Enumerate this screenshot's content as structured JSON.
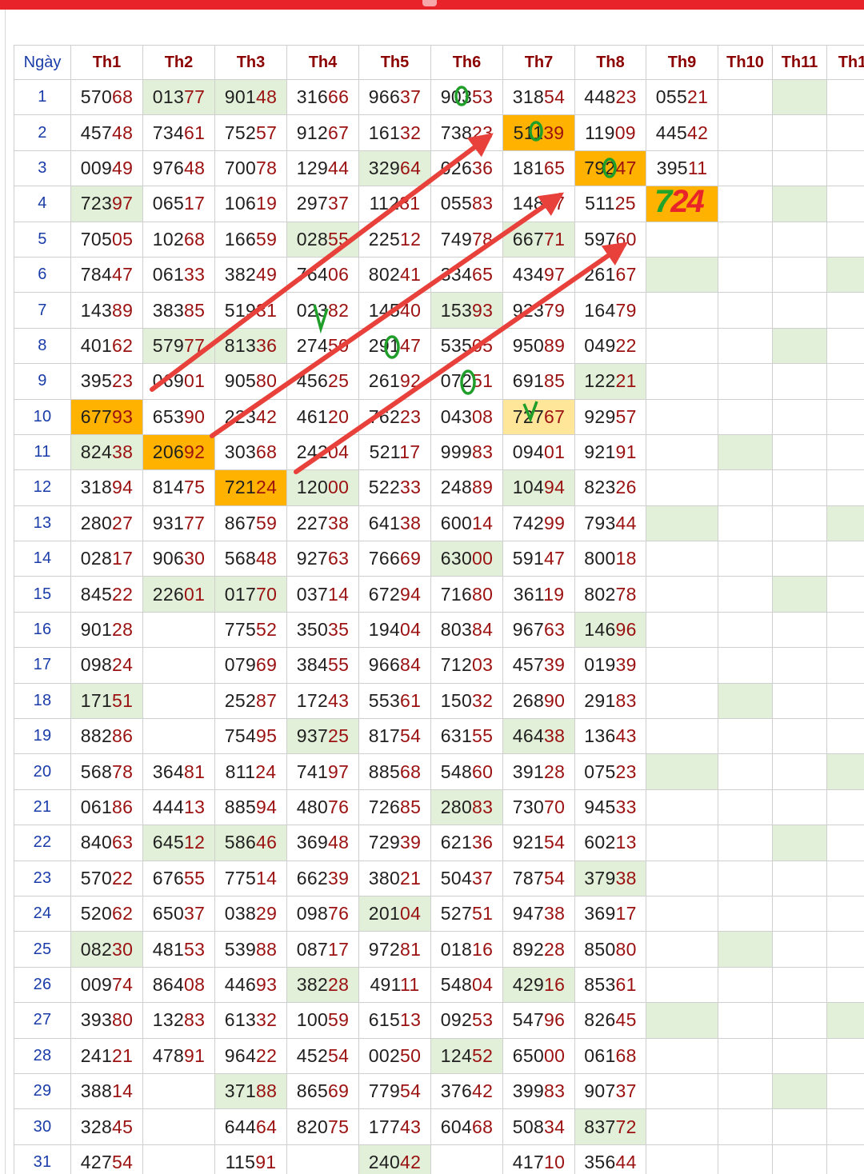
{
  "header": {
    "day_label": "Ngày",
    "months": [
      "Th1",
      "Th2",
      "Th3",
      "Th4",
      "Th5",
      "Th6",
      "Th7",
      "Th8",
      "Th9",
      "Th10",
      "Th11",
      "Th1"
    ]
  },
  "rows": [
    {
      "day": "1",
      "cells": [
        "57068",
        "01377",
        "90148",
        "31666",
        "96637",
        "90353",
        "31854",
        "44823",
        "05521",
        "",
        "",
        ""
      ]
    },
    {
      "day": "2",
      "cells": [
        "45748",
        "73461",
        "75257",
        "91267",
        "16132",
        "73823",
        "51139",
        "11909",
        "44542",
        "",
        "",
        ""
      ]
    },
    {
      "day": "3",
      "cells": [
        "00949",
        "97648",
        "70078",
        "12944",
        "32964",
        "02636",
        "18165",
        "79247",
        "39511",
        "",
        "",
        ""
      ]
    },
    {
      "day": "4",
      "cells": [
        "72397",
        "06517",
        "10619",
        "29737",
        "11281",
        "05583",
        "14887",
        "51125",
        "",
        "",
        "",
        ""
      ]
    },
    {
      "day": "5",
      "cells": [
        "70505",
        "10268",
        "16659",
        "02855",
        "22512",
        "74978",
        "66771",
        "59760",
        "",
        "",
        "",
        ""
      ]
    },
    {
      "day": "6",
      "cells": [
        "78447",
        "06133",
        "38249",
        "76406",
        "80241",
        "33465",
        "43497",
        "26167",
        "",
        "",
        "",
        ""
      ]
    },
    {
      "day": "7",
      "cells": [
        "14389",
        "38385",
        "51931",
        "02382",
        "14540",
        "15393",
        "92379",
        "16479",
        "",
        "",
        "",
        ""
      ]
    },
    {
      "day": "8",
      "cells": [
        "40162",
        "57977",
        "81336",
        "27450",
        "29147",
        "53505",
        "95089",
        "04922",
        "",
        "",
        "",
        ""
      ]
    },
    {
      "day": "9",
      "cells": [
        "39523",
        "06901",
        "90580",
        "45625",
        "26192",
        "07251",
        "69185",
        "12221",
        "",
        "",
        "",
        ""
      ]
    },
    {
      "day": "10",
      "cells": [
        "67793",
        "65390",
        "22342",
        "46120",
        "76223",
        "04308",
        "72767",
        "92957",
        "",
        "",
        "",
        ""
      ]
    },
    {
      "day": "11",
      "cells": [
        "82438",
        "20692",
        "30368",
        "24204",
        "52117",
        "99983",
        "09401",
        "92191",
        "",
        "",
        "",
        ""
      ]
    },
    {
      "day": "12",
      "cells": [
        "31894",
        "81475",
        "72124",
        "12000",
        "52233",
        "24889",
        "10494",
        "82326",
        "",
        "",
        "",
        ""
      ]
    },
    {
      "day": "13",
      "cells": [
        "28027",
        "93177",
        "86759",
        "22738",
        "64138",
        "60014",
        "74299",
        "79344",
        "",
        "",
        "",
        ""
      ]
    },
    {
      "day": "14",
      "cells": [
        "02817",
        "90630",
        "56848",
        "92763",
        "76669",
        "63000",
        "59147",
        "80018",
        "",
        "",
        "",
        ""
      ]
    },
    {
      "day": "15",
      "cells": [
        "84522",
        "22601",
        "01770",
        "03714",
        "67294",
        "71680",
        "36119",
        "80278",
        "",
        "",
        "",
        ""
      ]
    },
    {
      "day": "16",
      "cells": [
        "90128",
        "",
        "77552",
        "35035",
        "19404",
        "80384",
        "96763",
        "14696",
        "",
        "",
        "",
        ""
      ]
    },
    {
      "day": "17",
      "cells": [
        "09824",
        "",
        "07969",
        "38455",
        "96684",
        "71203",
        "45739",
        "01939",
        "",
        "",
        "",
        ""
      ]
    },
    {
      "day": "18",
      "cells": [
        "17151",
        "",
        "25287",
        "17243",
        "55361",
        "15032",
        "26890",
        "29183",
        "",
        "",
        "",
        ""
      ]
    },
    {
      "day": "19",
      "cells": [
        "88286",
        "",
        "75495",
        "93725",
        "81754",
        "63155",
        "46438",
        "13643",
        "",
        "",
        "",
        ""
      ]
    },
    {
      "day": "20",
      "cells": [
        "56878",
        "36481",
        "81124",
        "74197",
        "88568",
        "54860",
        "39128",
        "07523",
        "",
        "",
        "",
        ""
      ]
    },
    {
      "day": "21",
      "cells": [
        "06186",
        "44413",
        "88594",
        "48076",
        "72685",
        "28083",
        "73070",
        "94533",
        "",
        "",
        "",
        ""
      ]
    },
    {
      "day": "22",
      "cells": [
        "84063",
        "64512",
        "58646",
        "36948",
        "72939",
        "62136",
        "92154",
        "60213",
        "",
        "",
        "",
        ""
      ]
    },
    {
      "day": "23",
      "cells": [
        "57022",
        "67655",
        "77514",
        "66239",
        "38021",
        "50437",
        "78754",
        "37938",
        "",
        "",
        "",
        ""
      ]
    },
    {
      "day": "24",
      "cells": [
        "52062",
        "65037",
        "03829",
        "09876",
        "20104",
        "52751",
        "94738",
        "36917",
        "",
        "",
        "",
        ""
      ]
    },
    {
      "day": "25",
      "cells": [
        "08230",
        "48153",
        "53988",
        "08717",
        "97281",
        "01816",
        "89228",
        "85080",
        "",
        "",
        "",
        ""
      ]
    },
    {
      "day": "26",
      "cells": [
        "00974",
        "86408",
        "44693",
        "38228",
        "49111",
        "54804",
        "42916",
        "85361",
        "",
        "",
        "",
        ""
      ]
    },
    {
      "day": "27",
      "cells": [
        "39380",
        "13283",
        "61332",
        "10059",
        "61513",
        "09253",
        "54796",
        "82645",
        "",
        "",
        "",
        ""
      ]
    },
    {
      "day": "28",
      "cells": [
        "24121",
        "47891",
        "96422",
        "45254",
        "00250",
        "12452",
        "65000",
        "06168",
        "",
        "",
        "",
        ""
      ]
    },
    {
      "day": "29",
      "cells": [
        "38814",
        "",
        "37188",
        "86569",
        "77954",
        "37642",
        "39983",
        "90737",
        "",
        "",
        "",
        ""
      ]
    },
    {
      "day": "30",
      "cells": [
        "32845",
        "",
        "64464",
        "82075",
        "17743",
        "60468",
        "50834",
        "83772",
        "",
        "",
        "",
        ""
      ]
    },
    {
      "day": "31",
      "cells": [
        "42754",
        "",
        "11591",
        "",
        "24042",
        "",
        "41710",
        "35644",
        "",
        "",
        "",
        ""
      ]
    }
  ],
  "highlights": {
    "green": [
      [
        0,
        1
      ],
      [
        0,
        2
      ],
      [
        0,
        10
      ],
      [
        2,
        4
      ],
      [
        3,
        0
      ],
      [
        3,
        8
      ],
      [
        3,
        10
      ],
      [
        4,
        3
      ],
      [
        4,
        6
      ],
      [
        5,
        8
      ],
      [
        5,
        11
      ],
      [
        6,
        5
      ],
      [
        7,
        1
      ],
      [
        7,
        2
      ],
      [
        7,
        10
      ],
      [
        8,
        7
      ],
      [
        10,
        0
      ],
      [
        10,
        9
      ],
      [
        11,
        3
      ],
      [
        11,
        6
      ],
      [
        12,
        8
      ],
      [
        12,
        11
      ],
      [
        13,
        5
      ],
      [
        14,
        1
      ],
      [
        14,
        2
      ],
      [
        14,
        10
      ],
      [
        15,
        7
      ],
      [
        17,
        0
      ],
      [
        17,
        9
      ],
      [
        18,
        3
      ],
      [
        18,
        6
      ],
      [
        19,
        8
      ],
      [
        19,
        11
      ],
      [
        20,
        5
      ],
      [
        21,
        1
      ],
      [
        21,
        2
      ],
      [
        21,
        10
      ],
      [
        22,
        7
      ],
      [
        23,
        4
      ],
      [
        24,
        0
      ],
      [
        24,
        9
      ],
      [
        25,
        3
      ],
      [
        25,
        6
      ],
      [
        26,
        8
      ],
      [
        26,
        11
      ],
      [
        27,
        5
      ],
      [
        28,
        2
      ],
      [
        28,
        10
      ],
      [
        29,
        7
      ],
      [
        30,
        4
      ]
    ],
    "orange": [
      [
        1,
        6
      ],
      [
        2,
        7
      ],
      [
        3,
        8
      ],
      [
        9,
        0
      ],
      [
        10,
        1
      ],
      [
        11,
        2
      ]
    ],
    "yellow": [
      [
        9,
        6
      ]
    ]
  },
  "annotation": {
    "note_part1": "7",
    "note_part2": "24"
  },
  "colors": {
    "top_bar": "#e8232a",
    "arrow": "#e8403a",
    "circle_mark": "#1f9e2a",
    "cell_green": "#e2f0d9",
    "cell_orange": "#ffb300",
    "cell_yellow": "#ffe699",
    "head_text": "#8b0000",
    "day_text": "#1a3ca8"
  }
}
